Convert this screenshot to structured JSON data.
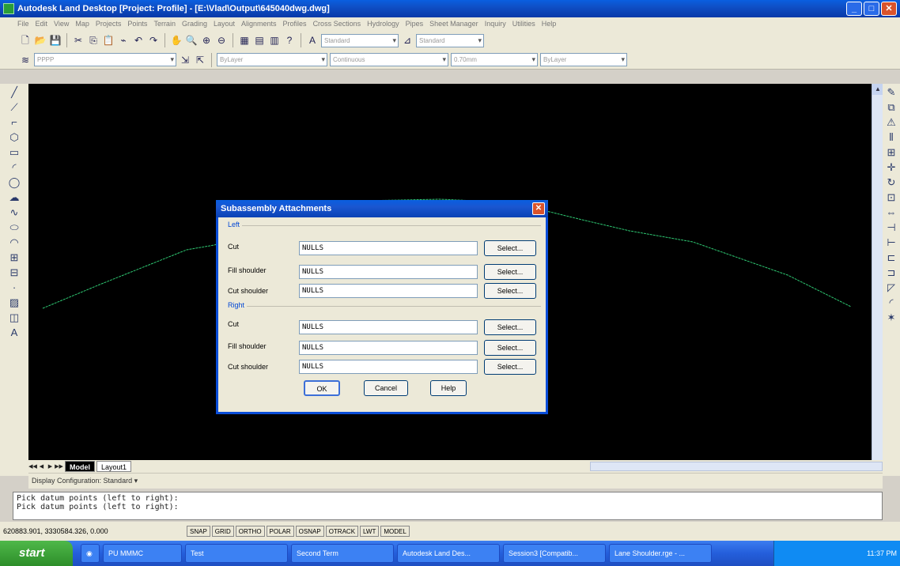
{
  "window": {
    "title": "Autodesk Land Desktop [Project: Profile] - [E:\\Vlad\\Output\\645040dwg.dwg]",
    "controls": {
      "minimize": "_",
      "maximize": "□",
      "close": "✕"
    }
  },
  "menubar": {
    "items": [
      "File",
      "Edit",
      "View",
      "Map",
      "Projects",
      "Points",
      "Terrain",
      "Grading",
      "Layout",
      "Alignments",
      "Profiles",
      "Cross Sections",
      "Hydrology",
      "Pipes",
      "Sheet Manager",
      "Inquiry",
      "Utilities",
      "Help"
    ]
  },
  "toolbars": {
    "text_style": "Standard",
    "dim_style": "Standard",
    "layer": "PPPP",
    "color": "ByLayer",
    "linetype": "Continuous",
    "lineweight": "0.70mm",
    "plot_style": "ByLayer"
  },
  "layout_tabs": [
    "Model",
    "Layout1"
  ],
  "display_config": "Display Configuration:  Standard ▾",
  "command_line": {
    "lines": [
      "Pick datum points (left to right):",
      "Pick datum points (left to right):"
    ]
  },
  "status": {
    "coords": "620883.901, 3330584.326, 0.000",
    "toggles": [
      "SNAP",
      "GRID",
      "ORTHO",
      "POLAR",
      "OSNAP",
      "OTRACK",
      "LWT",
      "MODEL"
    ]
  },
  "taskbar": {
    "start": "start",
    "tasks": [
      "PU MMMC",
      "Test",
      "Second Term",
      "Autodesk Land Des...",
      "Session3 [Compatib...",
      "Lane Shoulder.rge - ..."
    ],
    "clock": "11:37 PM"
  },
  "dialog": {
    "title": "Subassembly Attachments",
    "left_group": "Left",
    "right_group": "Right",
    "left_rows": [
      {
        "label": "Cut",
        "value": "NULLS",
        "button": "Select..."
      },
      {
        "label": "Fill shoulder",
        "value": "NULLS",
        "button": "Select..."
      },
      {
        "label": "Cut shoulder",
        "value": "NULLS",
        "button": "Select..."
      }
    ],
    "right_rows": [
      {
        "label": "Cut",
        "value": "NULLS",
        "button": "Select..."
      },
      {
        "label": "Fill shoulder",
        "value": "NULLS",
        "button": "Select..."
      },
      {
        "label": "Cut shoulder",
        "value": "NULLS",
        "button": "Select..."
      }
    ],
    "ok": "OK",
    "cancel": "Cancel",
    "help": "Help"
  },
  "colors": {
    "canvas": "#000000",
    "profile_line": "#2ec872",
    "titlebar": "#0a5fe0"
  }
}
